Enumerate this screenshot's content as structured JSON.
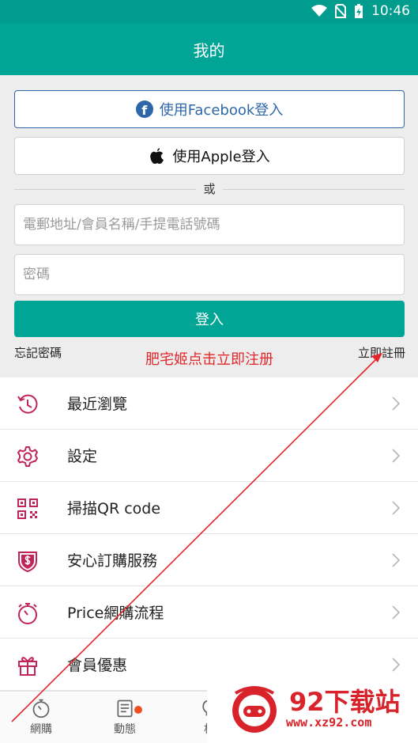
{
  "status_bar": {
    "time": "10:46",
    "colors": {
      "bg": "#009d8e"
    }
  },
  "app_bar": {
    "title": "我的"
  },
  "login": {
    "facebook_label": "使用Facebook登入",
    "apple_label": "使用Apple登入",
    "or_text": "或",
    "email_placeholder": "電郵地址/會員名稱/手提電話號碼",
    "password_placeholder": "密碼",
    "login_label": "登入",
    "forgot_label": "忘記密碼",
    "register_label": "立即註冊",
    "annotation": "肥宅姬点击立即注册"
  },
  "menu": {
    "items": [
      {
        "label": "最近瀏覽",
        "icon": "history-icon"
      },
      {
        "label": "設定",
        "icon": "gear-icon"
      },
      {
        "label": "掃描QR code",
        "icon": "qr-code-icon"
      },
      {
        "label": "安心訂購服務",
        "icon": "shield-dollar-icon"
      },
      {
        "label": "Price網購流程",
        "icon": "stopwatch-icon"
      },
      {
        "label": "會員優惠",
        "icon": "gift-icon"
      }
    ]
  },
  "bottom_nav": {
    "items": [
      {
        "label": "網購",
        "icon": "stopwatch-icon"
      },
      {
        "label": "動態",
        "icon": "news-icon",
        "badge": true
      },
      {
        "label": "格",
        "icon": "lightbulb-icon"
      }
    ]
  },
  "watermark": {
    "title": "92下载站",
    "url": "www.xz92.com"
  },
  "colors": {
    "primary": "#00a596",
    "facebook": "#2e67a8",
    "icon_accent": "#c0245a",
    "annotation": "#e3262a"
  }
}
